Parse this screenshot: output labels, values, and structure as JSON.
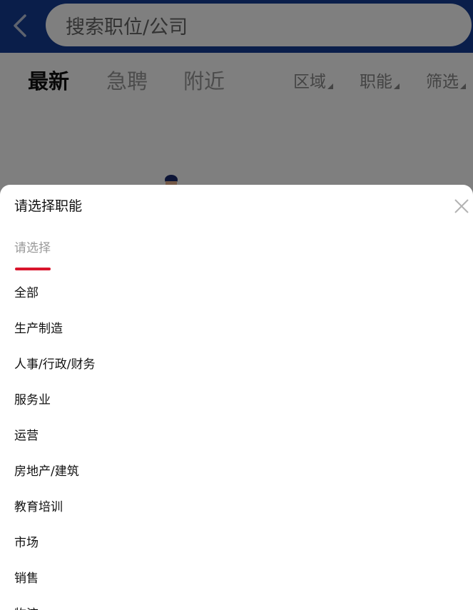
{
  "header": {
    "search_placeholder": "搜索职位/公司",
    "brand_color": "#143c94"
  },
  "filter_bar": {
    "tabs": [
      {
        "label": "最新",
        "active": true
      },
      {
        "label": "急聘",
        "active": false
      },
      {
        "label": "附近",
        "active": false
      }
    ],
    "dropdowns": [
      {
        "label": "区域"
      },
      {
        "label": "职能"
      },
      {
        "label": "筛选"
      }
    ]
  },
  "sheet": {
    "title": "请选择职能",
    "tab_label": "请选择",
    "accent_color": "#d9152c",
    "options": [
      "全部",
      "生产制造",
      "人事/行政/财务",
      "服务业",
      "运营",
      "房地产/建筑",
      "教育培训",
      "市场",
      "销售",
      "物流"
    ]
  },
  "icons": {
    "back": "chevron-left-icon",
    "close": "close-icon"
  }
}
